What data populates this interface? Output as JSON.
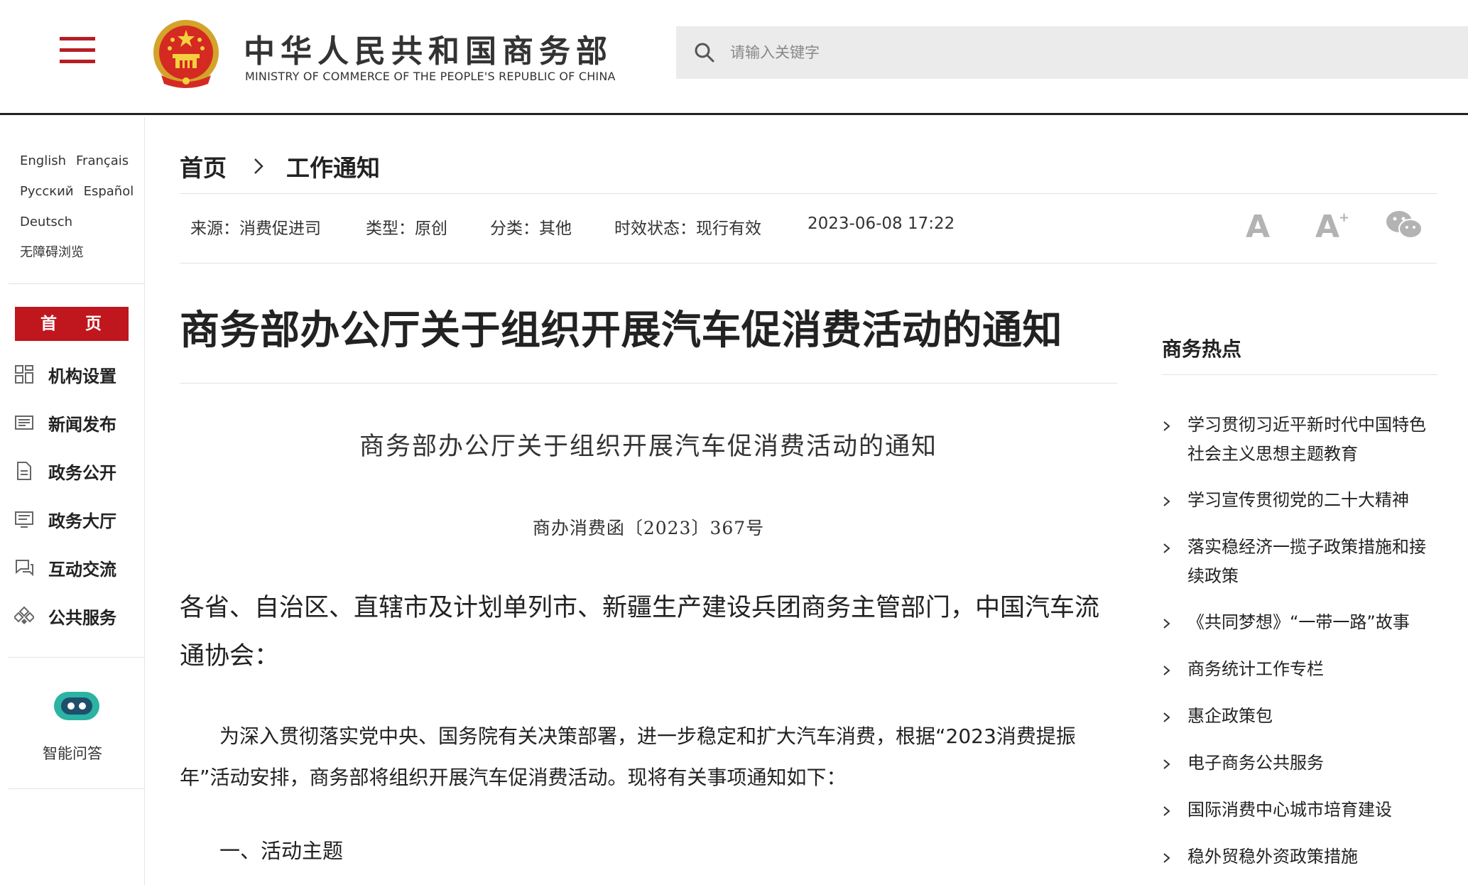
{
  "header": {
    "title": "中华人民共和国商务部",
    "subtitle": "MINISTRY OF COMMERCE OF THE PEOPLE'S REPUBLIC OF CHINA",
    "search_placeholder": "请输入关键字",
    "brand_color": "#b61e24"
  },
  "sidebar": {
    "languages": [
      "English",
      "Français",
      "Русский",
      "Español",
      "Deutsch"
    ],
    "accessibility": "无障碍浏览",
    "home_label": "首 页",
    "nav": [
      {
        "label": "机构设置",
        "icon": "grid-icon"
      },
      {
        "label": "新闻发布",
        "icon": "newspaper-icon"
      },
      {
        "label": "政务公开",
        "icon": "document-icon"
      },
      {
        "label": "政务大厅",
        "icon": "service-hall-icon"
      },
      {
        "label": "互动交流",
        "icon": "chat-icon"
      },
      {
        "label": "公共服务",
        "icon": "public-service-icon"
      }
    ],
    "assistant_label": "智能问答"
  },
  "breadcrumb": {
    "home": "首页",
    "current": "工作通知"
  },
  "meta": {
    "source": "来源：消费促进司",
    "type": "类型：原创",
    "category": "分类：其他",
    "status": "时效状态：现行有效",
    "datetime": "2023-06-08 17:22"
  },
  "article": {
    "title": "商务部办公厅关于组织开展汽车促消费活动的通知",
    "doc_title": "商务部办公厅关于组织开展汽车促消费活动的通知",
    "doc_number": "商办消费函〔2023〕367号",
    "recipients": "各省、自治区、直辖市及计划单列市、新疆生产建设兵团商务主管部门，中国汽车流通协会：",
    "body": "为深入贯彻落实党中央、国务院有关决策部署，进一步稳定和扩大汽车消费，根据“2023消费提振年”活动安排，商务部将组织开展汽车促消费活动。现将有关事项通知如下：",
    "section1": "一、活动主题"
  },
  "hot": {
    "title": "商务热点",
    "items": [
      "学习贯彻习近平新时代中国特色社会主义思想主题教育",
      "学习宣传贯彻党的二十大精神",
      "落实稳经济一揽子政策措施和接续政策",
      "《共同梦想》“一带一路”故事",
      "商务统计工作专栏",
      "惠企政策包",
      "电子商务公共服务",
      "国际消费中心城市培育建设",
      "稳外贸稳外资政策措施"
    ]
  }
}
